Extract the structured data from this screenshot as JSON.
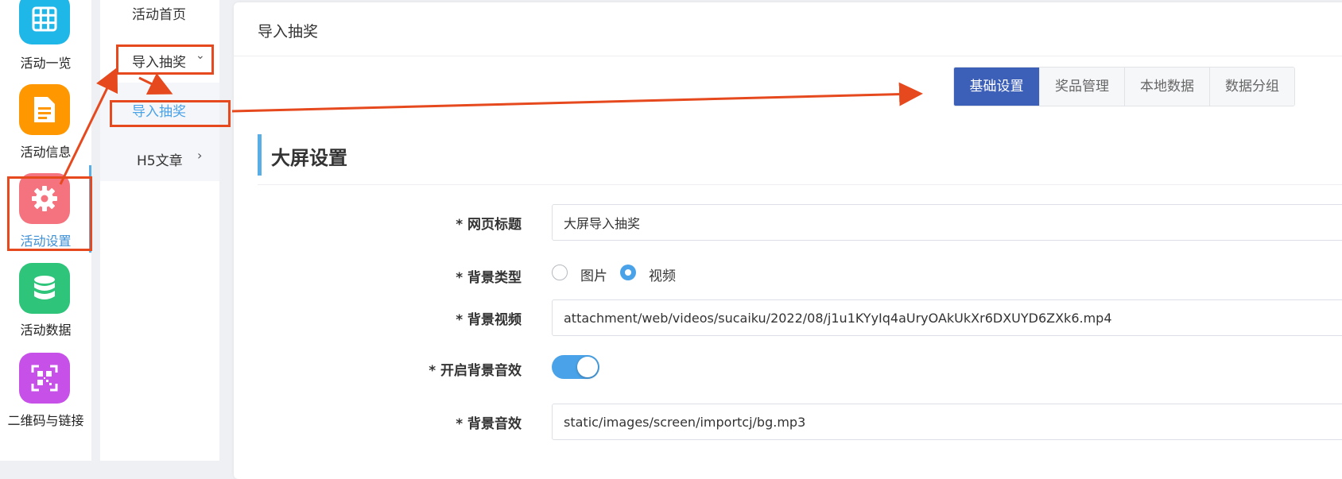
{
  "rail": {
    "items": [
      {
        "label": "活动一览",
        "icon": "grid-icon",
        "color": "#1fb6e8"
      },
      {
        "label": "活动信息",
        "icon": "document-icon",
        "color": "#ff9800"
      },
      {
        "label": "活动设置",
        "icon": "gear-icon",
        "color": "#f5737e",
        "active": true
      },
      {
        "label": "活动数据",
        "icon": "database-icon",
        "color": "#2ec47a"
      },
      {
        "label": "二维码与链接",
        "icon": "qrcode-icon",
        "color": "#c650e8"
      }
    ]
  },
  "submenu": {
    "home": "活动首页",
    "import_lottery": "导入抽奖",
    "import_lottery_child": "导入抽奖",
    "h5_article": "H5文章"
  },
  "main": {
    "title": "导入抽奖",
    "tabs": [
      "基础设置",
      "奖品管理",
      "本地数据",
      "数据分组"
    ],
    "section_title": "大屏设置",
    "form": {
      "page_title_label": "* 网页标题",
      "page_title_value": "大屏导入抽奖",
      "bg_type_label": "* 背景类型",
      "bg_type_options": [
        "图片",
        "视频"
      ],
      "bg_type_selected": "视频",
      "bg_video_label": "* 背景视频",
      "bg_video_value": "attachment/web/videos/sucaiku/2022/08/j1u1KYyIq4aUryOAkUkXr6DXUYD6ZXk6.mp4",
      "bg_sound_toggle_label": "* 开启背景音效",
      "bg_sound_enabled": true,
      "bg_sound_label": "* 背景音效",
      "bg_sound_value": "static/images/screen/importcj/bg.mp3"
    }
  },
  "colors": {
    "accent": "#3c5fb8",
    "annotation": "#e6491d",
    "active_blue": "#4aa3e8"
  }
}
